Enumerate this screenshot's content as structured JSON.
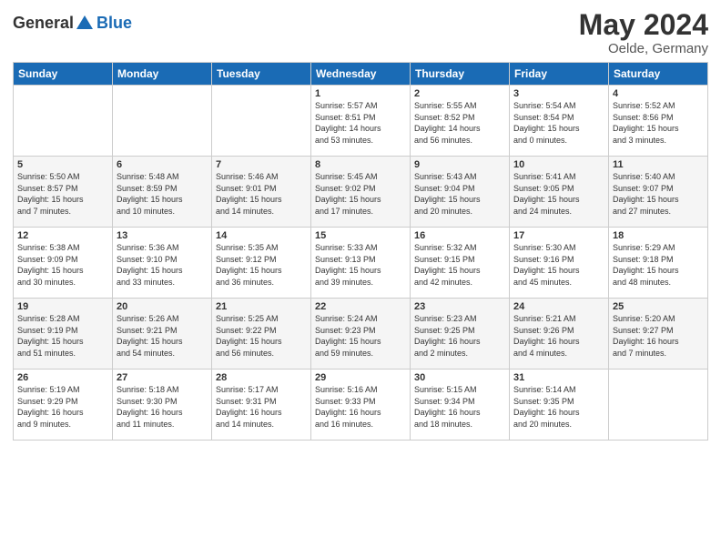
{
  "logo": {
    "general": "General",
    "blue": "Blue"
  },
  "header": {
    "month": "May 2024",
    "location": "Oelde, Germany"
  },
  "weekdays": [
    "Sunday",
    "Monday",
    "Tuesday",
    "Wednesday",
    "Thursday",
    "Friday",
    "Saturday"
  ],
  "weeks": [
    [
      {
        "day": "",
        "info": ""
      },
      {
        "day": "",
        "info": ""
      },
      {
        "day": "",
        "info": ""
      },
      {
        "day": "1",
        "info": "Sunrise: 5:57 AM\nSunset: 8:51 PM\nDaylight: 14 hours\nand 53 minutes."
      },
      {
        "day": "2",
        "info": "Sunrise: 5:55 AM\nSunset: 8:52 PM\nDaylight: 14 hours\nand 56 minutes."
      },
      {
        "day": "3",
        "info": "Sunrise: 5:54 AM\nSunset: 8:54 PM\nDaylight: 15 hours\nand 0 minutes."
      },
      {
        "day": "4",
        "info": "Sunrise: 5:52 AM\nSunset: 8:56 PM\nDaylight: 15 hours\nand 3 minutes."
      }
    ],
    [
      {
        "day": "5",
        "info": "Sunrise: 5:50 AM\nSunset: 8:57 PM\nDaylight: 15 hours\nand 7 minutes."
      },
      {
        "day": "6",
        "info": "Sunrise: 5:48 AM\nSunset: 8:59 PM\nDaylight: 15 hours\nand 10 minutes."
      },
      {
        "day": "7",
        "info": "Sunrise: 5:46 AM\nSunset: 9:01 PM\nDaylight: 15 hours\nand 14 minutes."
      },
      {
        "day": "8",
        "info": "Sunrise: 5:45 AM\nSunset: 9:02 PM\nDaylight: 15 hours\nand 17 minutes."
      },
      {
        "day": "9",
        "info": "Sunrise: 5:43 AM\nSunset: 9:04 PM\nDaylight: 15 hours\nand 20 minutes."
      },
      {
        "day": "10",
        "info": "Sunrise: 5:41 AM\nSunset: 9:05 PM\nDaylight: 15 hours\nand 24 minutes."
      },
      {
        "day": "11",
        "info": "Sunrise: 5:40 AM\nSunset: 9:07 PM\nDaylight: 15 hours\nand 27 minutes."
      }
    ],
    [
      {
        "day": "12",
        "info": "Sunrise: 5:38 AM\nSunset: 9:09 PM\nDaylight: 15 hours\nand 30 minutes."
      },
      {
        "day": "13",
        "info": "Sunrise: 5:36 AM\nSunset: 9:10 PM\nDaylight: 15 hours\nand 33 minutes."
      },
      {
        "day": "14",
        "info": "Sunrise: 5:35 AM\nSunset: 9:12 PM\nDaylight: 15 hours\nand 36 minutes."
      },
      {
        "day": "15",
        "info": "Sunrise: 5:33 AM\nSunset: 9:13 PM\nDaylight: 15 hours\nand 39 minutes."
      },
      {
        "day": "16",
        "info": "Sunrise: 5:32 AM\nSunset: 9:15 PM\nDaylight: 15 hours\nand 42 minutes."
      },
      {
        "day": "17",
        "info": "Sunrise: 5:30 AM\nSunset: 9:16 PM\nDaylight: 15 hours\nand 45 minutes."
      },
      {
        "day": "18",
        "info": "Sunrise: 5:29 AM\nSunset: 9:18 PM\nDaylight: 15 hours\nand 48 minutes."
      }
    ],
    [
      {
        "day": "19",
        "info": "Sunrise: 5:28 AM\nSunset: 9:19 PM\nDaylight: 15 hours\nand 51 minutes."
      },
      {
        "day": "20",
        "info": "Sunrise: 5:26 AM\nSunset: 9:21 PM\nDaylight: 15 hours\nand 54 minutes."
      },
      {
        "day": "21",
        "info": "Sunrise: 5:25 AM\nSunset: 9:22 PM\nDaylight: 15 hours\nand 56 minutes."
      },
      {
        "day": "22",
        "info": "Sunrise: 5:24 AM\nSunset: 9:23 PM\nDaylight: 15 hours\nand 59 minutes."
      },
      {
        "day": "23",
        "info": "Sunrise: 5:23 AM\nSunset: 9:25 PM\nDaylight: 16 hours\nand 2 minutes."
      },
      {
        "day": "24",
        "info": "Sunrise: 5:21 AM\nSunset: 9:26 PM\nDaylight: 16 hours\nand 4 minutes."
      },
      {
        "day": "25",
        "info": "Sunrise: 5:20 AM\nSunset: 9:27 PM\nDaylight: 16 hours\nand 7 minutes."
      }
    ],
    [
      {
        "day": "26",
        "info": "Sunrise: 5:19 AM\nSunset: 9:29 PM\nDaylight: 16 hours\nand 9 minutes."
      },
      {
        "day": "27",
        "info": "Sunrise: 5:18 AM\nSunset: 9:30 PM\nDaylight: 16 hours\nand 11 minutes."
      },
      {
        "day": "28",
        "info": "Sunrise: 5:17 AM\nSunset: 9:31 PM\nDaylight: 16 hours\nand 14 minutes."
      },
      {
        "day": "29",
        "info": "Sunrise: 5:16 AM\nSunset: 9:33 PM\nDaylight: 16 hours\nand 16 minutes."
      },
      {
        "day": "30",
        "info": "Sunrise: 5:15 AM\nSunset: 9:34 PM\nDaylight: 16 hours\nand 18 minutes."
      },
      {
        "day": "31",
        "info": "Sunrise: 5:14 AM\nSunset: 9:35 PM\nDaylight: 16 hours\nand 20 minutes."
      },
      {
        "day": "",
        "info": ""
      }
    ]
  ]
}
